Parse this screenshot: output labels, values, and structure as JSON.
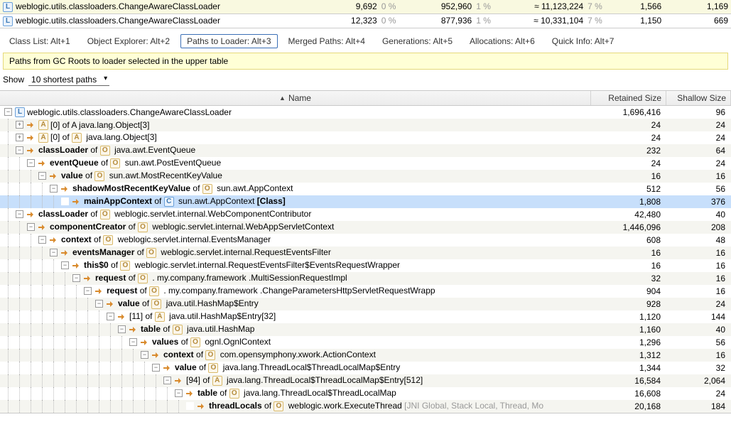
{
  "top_rows": [
    {
      "icon": "L",
      "name": "weblogic.utils.classloaders.ChangeAwareClassLoader",
      "c1": "9,692",
      "p1": "0 %",
      "c2": "952,960",
      "p2": "1 %",
      "c3": "≈ 11,123,224",
      "p3": "7 %",
      "c4": "1,566",
      "c5": "1,169"
    },
    {
      "icon": "L",
      "name": "weblogic.utils.classloaders.ChangeAwareClassLoader",
      "c1": "12,323",
      "p1": "0 %",
      "c2": "877,936",
      "p2": "1 %",
      "c3": "≈ 10,331,104",
      "p3": "7 %",
      "c4": "1,150",
      "c5": "669"
    }
  ],
  "tabs": [
    {
      "label": "Class List: Alt+1",
      "active": false
    },
    {
      "label": "Object Explorer: Alt+2",
      "active": false
    },
    {
      "label": "Paths to Loader: Alt+3",
      "active": true
    },
    {
      "label": "Merged Paths: Alt+4",
      "active": false
    },
    {
      "label": "Generations: Alt+5",
      "active": false
    },
    {
      "label": "Allocations: Alt+6",
      "active": false
    },
    {
      "label": "Quick Info: Alt+7",
      "active": false
    }
  ],
  "info_text": "Paths from GC Roots to loader selected in the upper table",
  "show_label": "Show",
  "show_value": "10 shortest paths",
  "headers": {
    "name": "Name",
    "retained": "Retained Size",
    "shallow": "Shallow Size"
  },
  "tree": [
    {
      "depth": 0,
      "toggle": "-",
      "ref": false,
      "ico": "L",
      "html": "weblogic.utils.classloaders.ChangeAwareClassLoader",
      "ret": "1,696,416",
      "shal": "96",
      "sel": false
    },
    {
      "depth": 1,
      "toggle": "+",
      "ref": true,
      "ico": "A",
      "html": "[0] of <ico>A</ico> java.lang.Object[3]",
      "ret": "24",
      "shal": "24",
      "sel": false,
      "preText": "[0] of ",
      "ico2": "A",
      "postText": "java.lang.Object[3]"
    },
    {
      "depth": 1,
      "toggle": "+",
      "ref": true,
      "ico": "A",
      "preText": "[0] of ",
      "ico2": "A",
      "postText": "java.lang.Object[3]",
      "ret": "24",
      "shal": "24",
      "sel": false
    },
    {
      "depth": 1,
      "toggle": "-",
      "ref": true,
      "ico": "",
      "preBold": "classLoader",
      "midText": " of ",
      "ico2": "O",
      "postText": "java.awt.EventQueue",
      "ret": "232",
      "shal": "64",
      "sel": false
    },
    {
      "depth": 2,
      "toggle": "-",
      "ref": true,
      "preBold": "eventQueue",
      "midText": " of ",
      "ico2": "O",
      "postText": "sun.awt.PostEventQueue",
      "ret": "24",
      "shal": "24",
      "sel": false
    },
    {
      "depth": 3,
      "toggle": "-",
      "ref": true,
      "preBold": "value",
      "midText": " of ",
      "ico2": "O",
      "postText": "sun.awt.MostRecentKeyValue",
      "ret": "16",
      "shal": "16",
      "sel": false
    },
    {
      "depth": 4,
      "toggle": "-",
      "ref": true,
      "preBold": "shadowMostRecentKeyValue",
      "midText": " of ",
      "ico2": "O",
      "postText": "sun.awt.AppContext",
      "ret": "512",
      "shal": "56",
      "sel": false
    },
    {
      "depth": 5,
      "toggle": "",
      "ref": true,
      "preBold": "mainAppContext",
      "midText": " of ",
      "ico2": "C",
      "postText": "sun.awt.AppContext",
      "suffixBold": " [Class]",
      "ret": "1,808",
      "shal": "376",
      "sel": true
    },
    {
      "depth": 1,
      "toggle": "-",
      "ref": true,
      "preBold": "classLoader",
      "midText": " of ",
      "ico2": "O",
      "postText": "weblogic.servlet.internal.WebComponentContributor",
      "ret": "42,480",
      "shal": "40",
      "sel": false
    },
    {
      "depth": 2,
      "toggle": "-",
      "ref": true,
      "preBold": "componentCreator",
      "midText": " of ",
      "ico2": "O",
      "postText": "weblogic.servlet.internal.WebAppServletContext",
      "ret": "1,446,096",
      "shal": "208",
      "sel": false
    },
    {
      "depth": 3,
      "toggle": "-",
      "ref": true,
      "preBold": "context",
      "midText": " of ",
      "ico2": "O",
      "postText": "weblogic.servlet.internal.EventsManager",
      "ret": "608",
      "shal": "48",
      "sel": false
    },
    {
      "depth": 4,
      "toggle": "-",
      "ref": true,
      "preBold": "eventsManager",
      "midText": " of ",
      "ico2": "O",
      "postText": "weblogic.servlet.internal.RequestEventsFilter",
      "ret": "16",
      "shal": "16",
      "sel": false
    },
    {
      "depth": 5,
      "toggle": "-",
      "ref": true,
      "preBold": "this$0",
      "midText": " of ",
      "ico2": "O",
      "postText": "weblogic.servlet.internal.RequestEventsFilter$EventsRequestWrapper",
      "ret": "16",
      "shal": "16",
      "sel": false
    },
    {
      "depth": 6,
      "toggle": "-",
      "ref": true,
      "preBold": "request",
      "midText": " of ",
      "ico2": "O",
      "postText": ".                               my.company.framework .MultiSessionRequestImpl",
      "ret": "32",
      "shal": "16",
      "sel": false
    },
    {
      "depth": 7,
      "toggle": "-",
      "ref": true,
      "preBold": "request",
      "midText": " of ",
      "ico2": "O",
      "postText": ".                                        my.company.framework .ChangeParametersHttpServletRequestWrapp",
      "ret": "904",
      "shal": "16",
      "sel": false
    },
    {
      "depth": 8,
      "toggle": "-",
      "ref": true,
      "preBold": "value",
      "midText": " of ",
      "ico2": "O",
      "postText": "java.util.HashMap$Entry",
      "ret": "928",
      "shal": "24",
      "sel": false
    },
    {
      "depth": 9,
      "toggle": "-",
      "ref": true,
      "preText": "[11] of ",
      "ico2": "A",
      "postText": "java.util.HashMap$Entry[32]",
      "ret": "1,120",
      "shal": "144",
      "sel": false
    },
    {
      "depth": 10,
      "toggle": "-",
      "ref": true,
      "preBold": "table",
      "midText": " of ",
      "ico2": "O",
      "postText": "java.util.HashMap",
      "ret": "1,160",
      "shal": "40",
      "sel": false
    },
    {
      "depth": 11,
      "toggle": "-",
      "ref": true,
      "preBold": "values",
      "midText": " of ",
      "ico2": "O",
      "postText": "ognl.OgnlContext",
      "ret": "1,296",
      "shal": "56",
      "sel": false
    },
    {
      "depth": 12,
      "toggle": "-",
      "ref": true,
      "preBold": "context",
      "midText": " of ",
      "ico2": "O",
      "postText": "com.opensymphony.xwork.ActionContext",
      "ret": "1,312",
      "shal": "16",
      "sel": false
    },
    {
      "depth": 13,
      "toggle": "-",
      "ref": true,
      "preBold": "value",
      "midText": " of ",
      "ico2": "O",
      "postText": "java.lang.ThreadLocal$ThreadLocalMap$Entry",
      "ret": "1,344",
      "shal": "32",
      "sel": false
    },
    {
      "depth": 14,
      "toggle": "-",
      "ref": true,
      "preText": "[94] of ",
      "ico2": "A",
      "postText": "java.lang.ThreadLocal$ThreadLocalMap$Entry[512]",
      "ret": "16,584",
      "shal": "2,064",
      "sel": false
    },
    {
      "depth": 15,
      "toggle": "-",
      "ref": true,
      "preBold": "table",
      "midText": " of ",
      "ico2": "O",
      "postText": "java.lang.ThreadLocal$ThreadLocalMap",
      "ret": "16,608",
      "shal": "24",
      "sel": false
    },
    {
      "depth": 16,
      "toggle": "",
      "ref": true,
      "preBold": "threadLocals",
      "midText": " of ",
      "ico2": "O",
      "postText": "weblogic.work.ExecuteThread",
      "suffixGray": " [JNI Global, Stack Local, Thread, Mo",
      "ret": "20,168",
      "shal": "184",
      "sel": false
    }
  ]
}
